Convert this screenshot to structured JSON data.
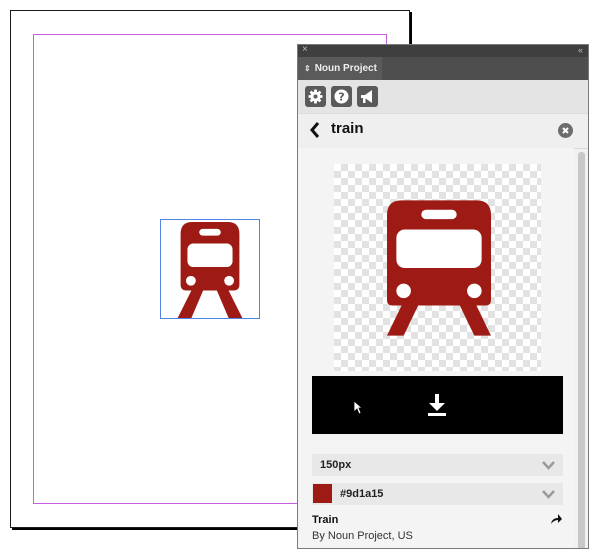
{
  "canvas": {
    "placed_icon": "train-icon",
    "placed_icon_color": "#9d1a15",
    "guide_color": "#c660e0",
    "frame_color": "#4f86e6"
  },
  "panel": {
    "close_glyph": "×",
    "collapse_glyph": "‹‹",
    "tab_title": "Noun Project",
    "tab_arrows": "⇕",
    "toolbar": {
      "buttons": [
        "gear-icon",
        "help-icon",
        "megaphone-icon"
      ]
    },
    "search": {
      "term": "train",
      "back_icon": "chevron-left-icon",
      "clear_icon": "clear-icon"
    },
    "preview": {
      "icon": "train-icon",
      "color": "#9d1a15"
    },
    "download": {
      "icon": "download-icon"
    },
    "size": {
      "value": "150px"
    },
    "color": {
      "hex": "#9d1a15"
    },
    "icon_info": {
      "name": "Train",
      "author": "By Noun Project, US"
    }
  }
}
